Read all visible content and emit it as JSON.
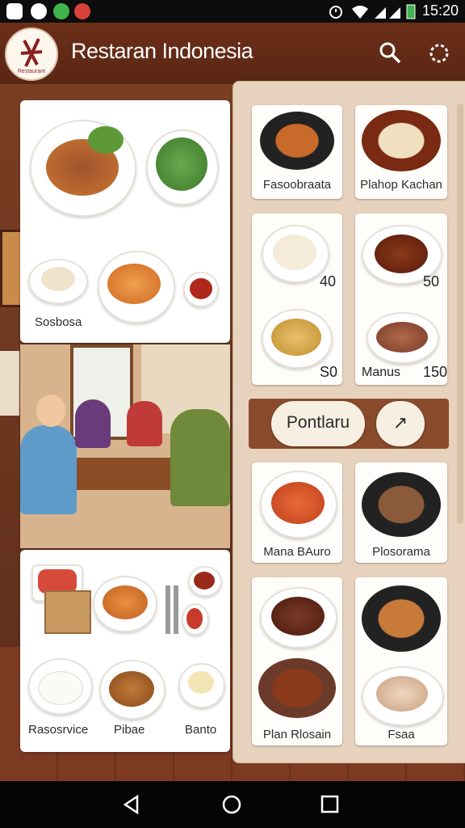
{
  "status_bar": {
    "time": "15:20"
  },
  "app": {
    "title": "Restaran Indonesia",
    "logo_text": "Restaurant"
  },
  "left_cards": {
    "card1_label": "Sosbosa",
    "card3_labels": [
      "Rasosrvice",
      "Pibae",
      "Banto"
    ]
  },
  "right_panel": {
    "row1": [
      "Fasoobraata",
      "Plahop Kachan"
    ],
    "row2_prices": [
      "40",
      "50"
    ],
    "row3": {
      "left_price": "S0",
      "right_label": "Manus",
      "right_price": "150"
    },
    "promo_button": "Pontlaru",
    "promo_arrow": "↗",
    "row4": [
      "Mana BAuro",
      "Plosorama"
    ],
    "row5": [
      "Plan Rlosain",
      "Fsaa"
    ]
  },
  "colors": {
    "appbar": "#6b2f18",
    "panel": "#e6d2bd",
    "promo": "#8a4a2c"
  }
}
